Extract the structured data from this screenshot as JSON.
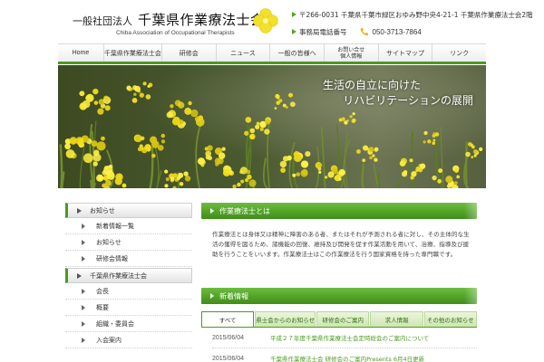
{
  "header": {
    "org_prefix": "一般社団法人",
    "org_name": "千葉県作業療法士会",
    "org_name_en": "Chiba Association of Occupational Therapists",
    "address": "〒266-0031 千葉県千葉市緑区おゆみ野中央4-21-1 千葉県作業療法士会2階",
    "office_label": "事務局電話番号",
    "tel": "050-3713-7864",
    "logo_color": "#f2e02a"
  },
  "nav": {
    "items": [
      {
        "label": "Home"
      },
      {
        "label": "千葉県作業療法士会"
      },
      {
        "label": "研修会"
      },
      {
        "label": "ニュース"
      },
      {
        "label": "一般の皆様へ"
      },
      {
        "label_line1": "お問い合せ",
        "label_line2": "個人情報"
      },
      {
        "label": "サイトマップ"
      },
      {
        "label": "リンク"
      }
    ]
  },
  "hero": {
    "line1": "生活の自立に向けた",
    "line2": "リハビリテーションの展開"
  },
  "sidebar": {
    "section1": {
      "title": "お知らせ",
      "items": [
        "新着情報一覧",
        "お知らせ",
        "研修会情報"
      ]
    },
    "section2": {
      "title": "千葉県作業療法士会",
      "items": [
        "会長",
        "概要",
        "組織・委員会",
        "入会案内"
      ]
    }
  },
  "main": {
    "about": {
      "title": "作業療法士とは",
      "text": "作業療法とは身体又は精神に障害のある者、またはそれが予測される者に対し、その主体的な生活の獲得を図るため、諸機能の回復、維持及び開発を促す作業活動を用いて、治療、指導及び援助を行うことをいいます。作業療法士はこの作業療法を行う国家資格を持った専門職です。"
    },
    "news": {
      "title": "新着情報",
      "tabs": [
        "すべて",
        "県士会からのお知らせ",
        "研修会のご案内",
        "求人情報",
        "その他のお知らせ"
      ],
      "items": [
        {
          "date": "2015/06/04",
          "title": "平成２７年度千葉県作業療法士会定時総会のご案内について"
        },
        {
          "date": "2015/06/04",
          "title": "千葉県作業療法士会 研修会のご案内Presents 6月4日更新"
        }
      ]
    }
  },
  "colors": {
    "accent_green": "#4c9a1e",
    "header_green": "#6bbd3e"
  }
}
